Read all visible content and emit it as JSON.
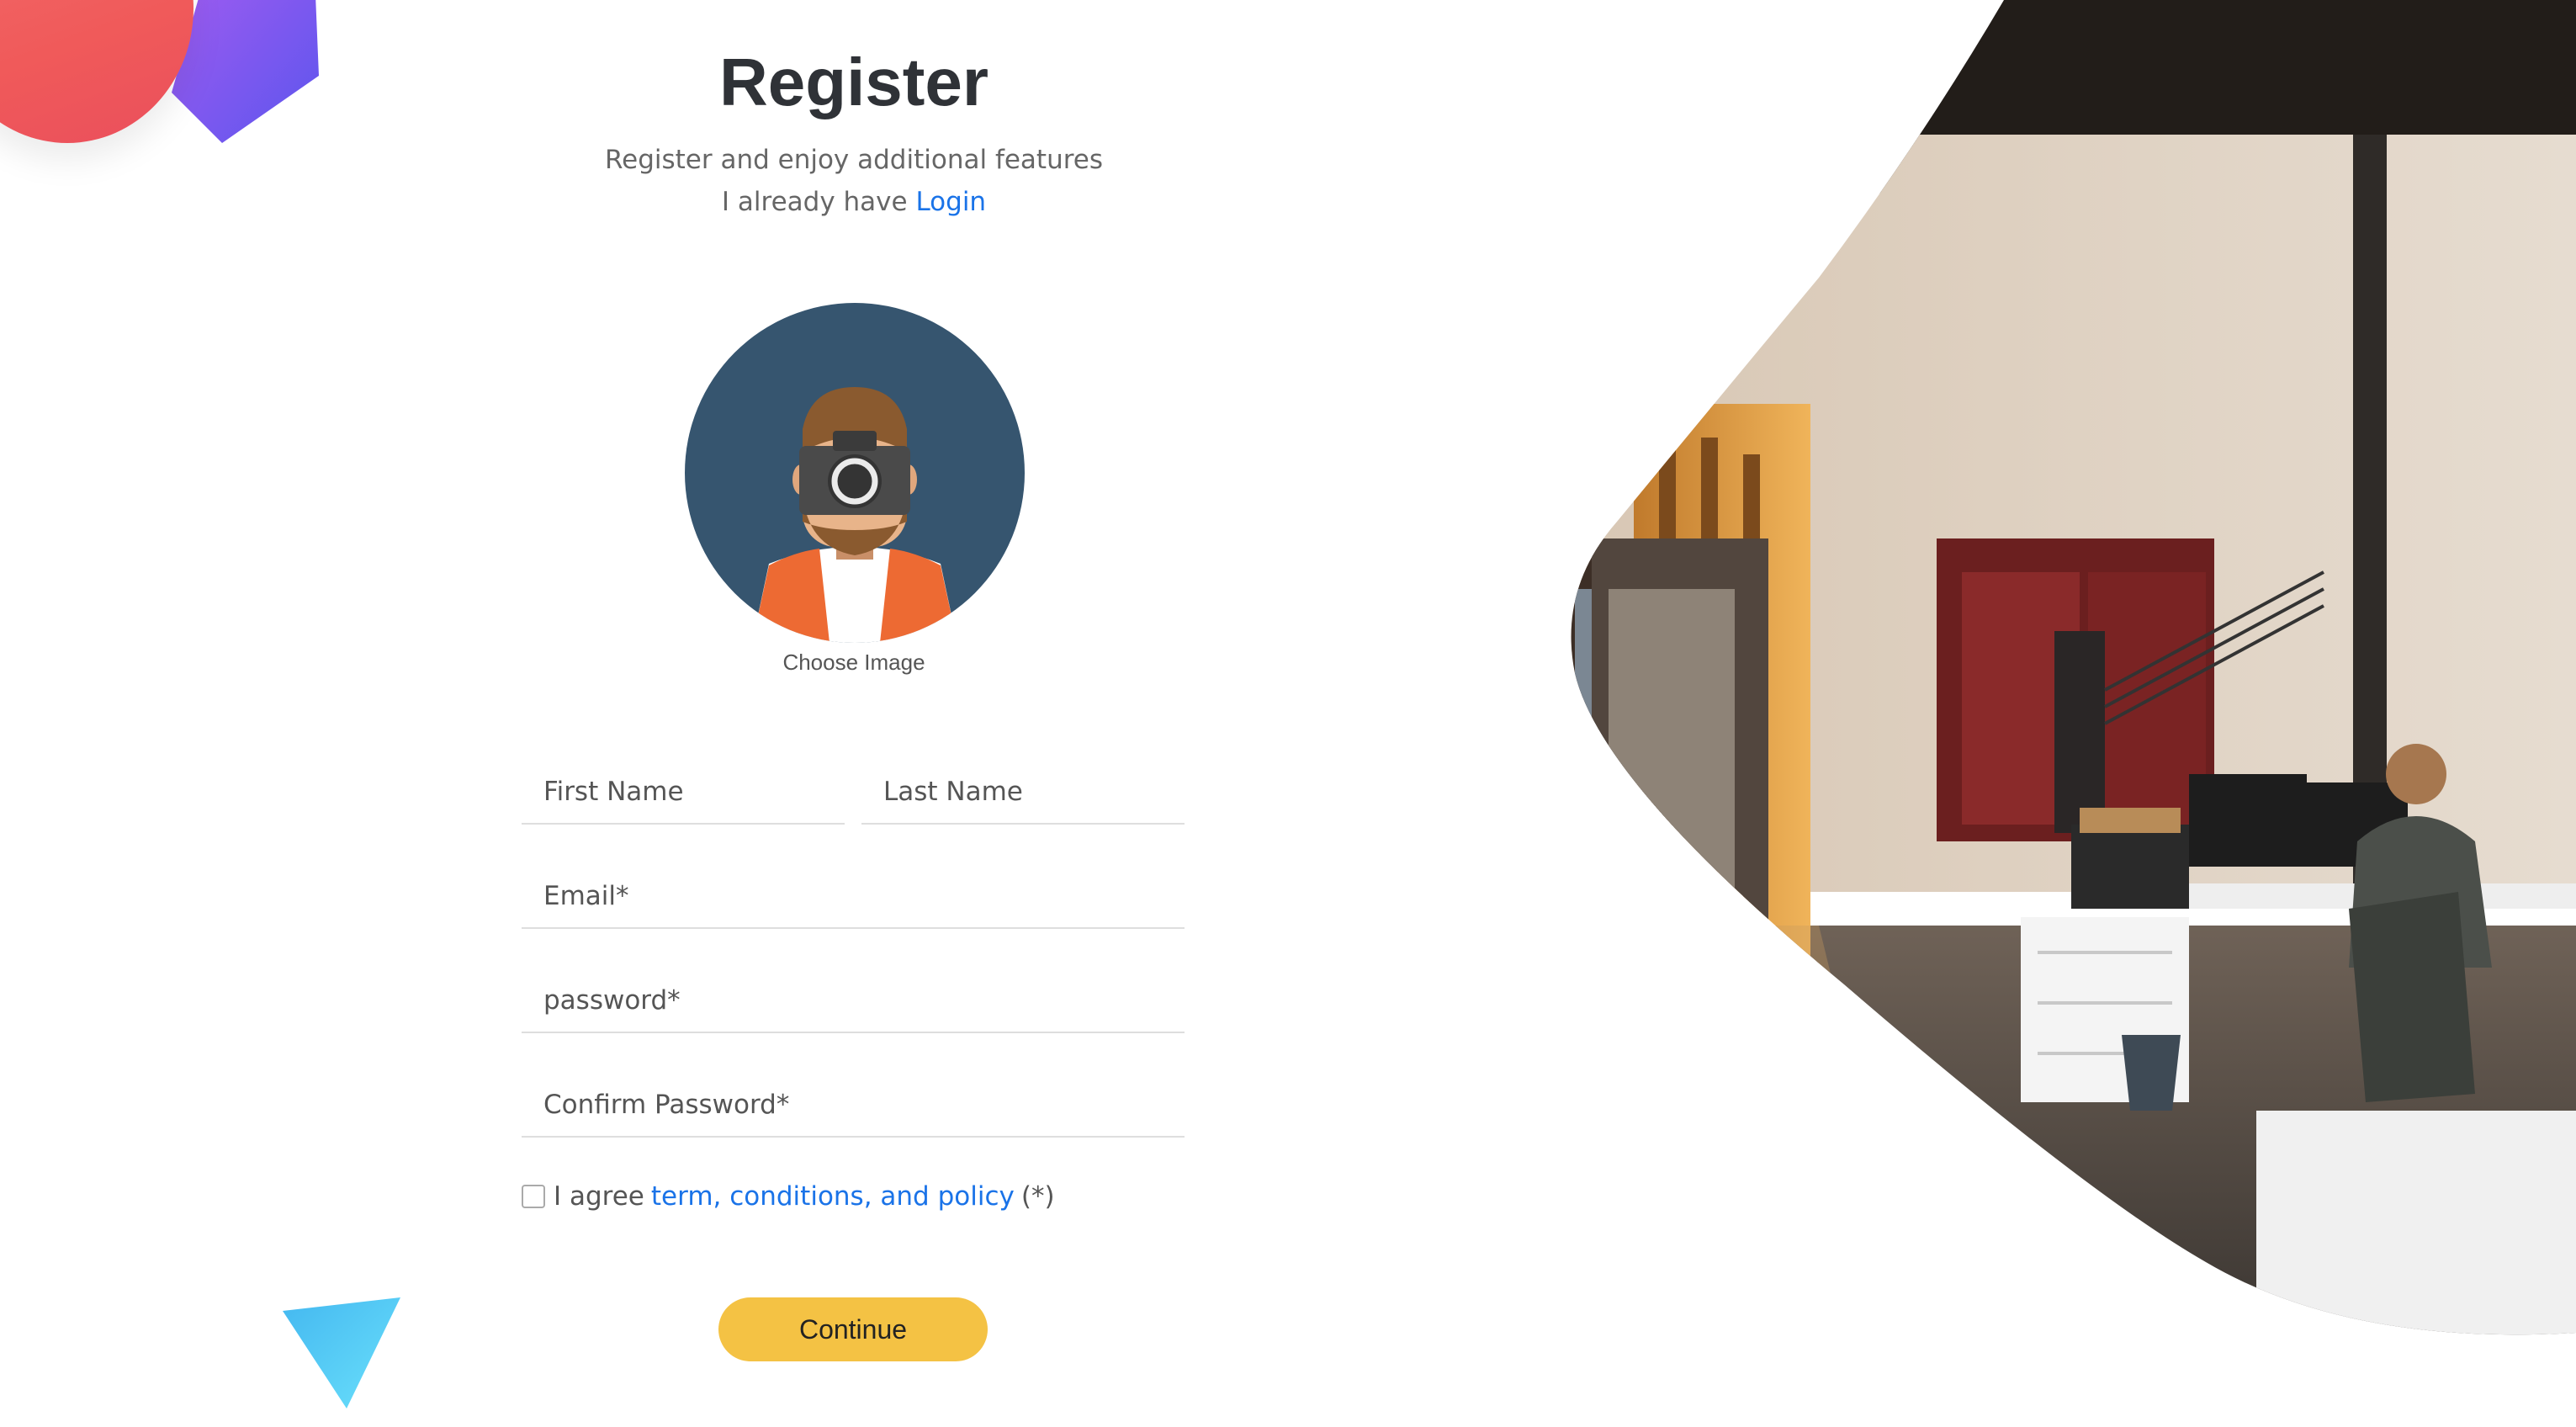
{
  "header": {
    "title": "Register",
    "subtitle": "Register and enjoy additional features",
    "login_prefix": "I already have",
    "login_link": "Login"
  },
  "avatar": {
    "choose_label": "Choose Image"
  },
  "form": {
    "first_name_placeholder": "First Name",
    "last_name_placeholder": "Last Name",
    "email_placeholder": "Email*",
    "password_placeholder": "password*",
    "confirm_password_placeholder": "Confirm Password*",
    "agree_prefix": "I agree",
    "agree_link": "term, conditions, and policy",
    "agree_suffix": "(*)",
    "agree_checked": false,
    "continue_label": "Continue"
  },
  "colors": {
    "accent_button": "#f4c244",
    "link": "#1a73e8",
    "avatar_bg": "#36556f"
  },
  "icons": {
    "avatar_illustration": "photographer-avatar-icon",
    "camera": "camera-icon"
  }
}
